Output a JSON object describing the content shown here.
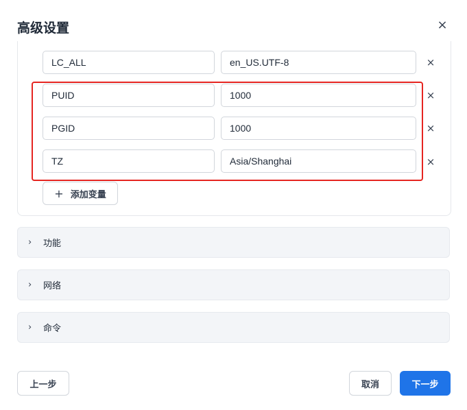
{
  "dialog": {
    "title": "高级设置",
    "close_glyph": "×"
  },
  "env": {
    "rows": [
      {
        "key": "LC_ALL",
        "value": "en_US.UTF-8",
        "remove_glyph": "×"
      },
      {
        "key": "PUID",
        "value": "1000",
        "remove_glyph": "×"
      },
      {
        "key": "PGID",
        "value": "1000",
        "remove_glyph": "×"
      },
      {
        "key": "TZ",
        "value": "Asia/Shanghai",
        "remove_glyph": "×"
      }
    ],
    "add_button": {
      "icon": "plus-icon",
      "glyph": "+",
      "label": "添加变量"
    }
  },
  "sections": [
    {
      "label": "功能",
      "chevron": "›"
    },
    {
      "label": "网络",
      "chevron": "›"
    },
    {
      "label": "命令",
      "chevron": "›"
    }
  ],
  "footer": {
    "prev_label": "上一步",
    "cancel_label": "取消",
    "next_label": "下一步"
  },
  "colors": {
    "primary": "#1f74e8",
    "highlight": "#e52420",
    "section_bg": "#f3f5f8"
  }
}
